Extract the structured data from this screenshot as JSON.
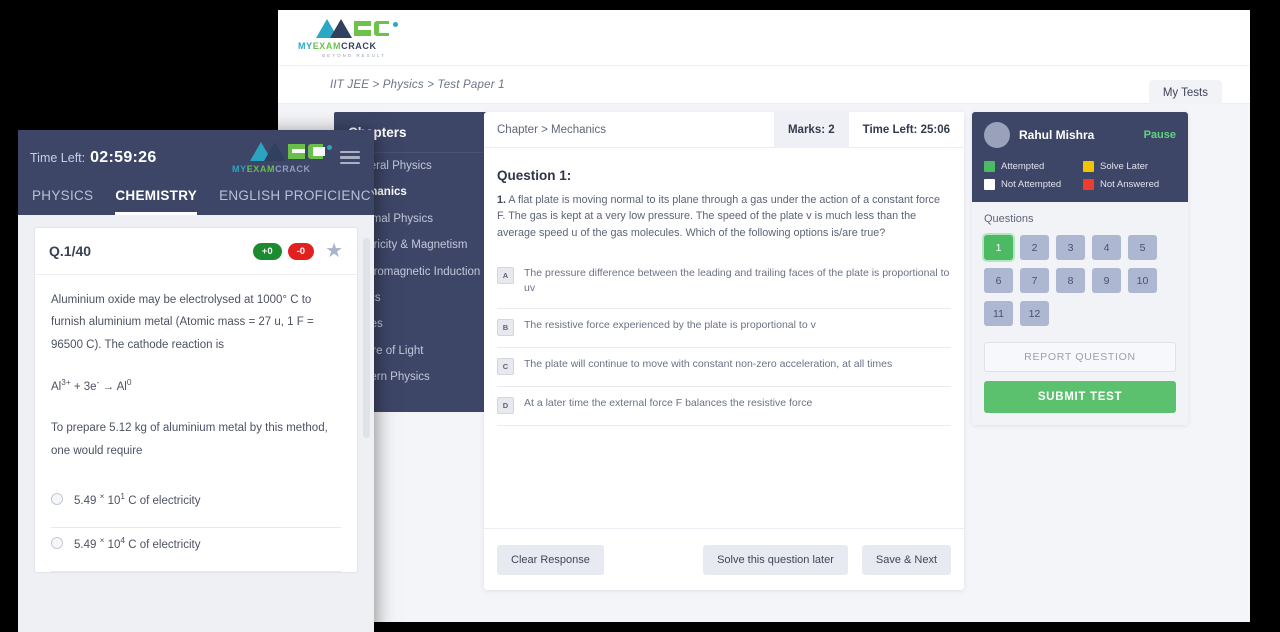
{
  "desktop": {
    "logo": {
      "mark": "mec-monogram",
      "word_my": "MY",
      "word_exam": "EXAM",
      "word_crack": "CRACK",
      "tagline": "BEYOND RESULT"
    },
    "breadcrumb": "IIT JEE > Physics > Test Paper 1",
    "my_tests_label": "My Tests",
    "chapters": {
      "title": "Chapters",
      "items": [
        {
          "label": "General Physics",
          "active": false
        },
        {
          "label": "Mechanics",
          "active": true
        },
        {
          "label": "Thermal Physics",
          "active": false
        },
        {
          "label": "Electricity & Magnetism",
          "active": false
        },
        {
          "label": "Electromagnetic Induction",
          "active": false
        },
        {
          "label": "Optics",
          "active": false
        },
        {
          "label": "Waves",
          "active": false
        },
        {
          "label": "Nature of Light",
          "active": false
        },
        {
          "label": "Modern Physics",
          "active": false
        }
      ]
    },
    "question": {
      "chapter_label": "Chapter > Mechanics",
      "marks": "Marks: 2",
      "time_left": "Time Left: 25:06",
      "title": "Question 1:",
      "number": "1.",
      "text": "A flat plate is moving normal to its plane through a gas under the action of a constant force F. The gas is kept at a very low pressure. The speed of the plate v is much less than the average speed u of the gas molecules. Which of the following options is/are true?",
      "options": [
        {
          "letter": "A",
          "text": "The pressure difference between the leading and trailing faces of the plate is proportional to uv"
        },
        {
          "letter": "B",
          "text": "The resistive force experienced by the plate is proportional to v"
        },
        {
          "letter": "C",
          "text": "The plate will continue to move with constant non-zero acceleration, at all times"
        },
        {
          "letter": "D",
          "text": "At a later time the external force F balances the resistive force"
        }
      ],
      "clear_label": "Clear Response",
      "later_label": "Solve this question later",
      "save_next_label": "Save & Next"
    },
    "panel": {
      "user_name": "Rahul Mishra",
      "pause_label": "Pause",
      "legend": [
        {
          "label": "Attempted",
          "color": "#4cb963"
        },
        {
          "label": "Solve Later",
          "color": "#f5c400"
        },
        {
          "label": "Not Attempted",
          "color": "#ffffff"
        },
        {
          "label": "Not Answered",
          "color": "#f03c2e"
        }
      ],
      "questions_title": "Questions",
      "questions": [
        {
          "n": "1",
          "state": "attempted"
        },
        {
          "n": "2",
          "state": "default"
        },
        {
          "n": "3",
          "state": "default"
        },
        {
          "n": "4",
          "state": "default"
        },
        {
          "n": "5",
          "state": "default"
        },
        {
          "n": "6",
          "state": "default"
        },
        {
          "n": "7",
          "state": "default"
        },
        {
          "n": "8",
          "state": "default"
        },
        {
          "n": "9",
          "state": "default"
        },
        {
          "n": "10",
          "state": "default"
        },
        {
          "n": "11",
          "state": "default"
        },
        {
          "n": "12",
          "state": "default"
        }
      ],
      "report_label": "REPORT QUESTION",
      "submit_label": "SUBMIT TEST"
    }
  },
  "mobile": {
    "time_label": "Time Left:",
    "time_value": "02:59:26",
    "menu_icon": "hamburger-icon",
    "tabs": [
      {
        "label": "PHYSICS",
        "active": false
      },
      {
        "label": "CHEMISTRY",
        "active": true
      },
      {
        "label": "ENGLISH PROFICIENCY",
        "active": false
      }
    ],
    "card": {
      "question_no": "Q.1/40",
      "positive_marks": "+0",
      "negative_marks": "-0",
      "bookmark_icon": "star-icon",
      "text": "Aluminium oxide may be electrolysed at 1000° C to furnish aluminium metal (Atomic mass = 27 u, 1 F = 96500 C). The cathode reaction is",
      "equation_lhs": "Al",
      "equation_lhs_sup": "3+",
      "equation_mid": " + 3e",
      "equation_mid_sup": "-",
      "equation_arrow": "→",
      "equation_rhs": "Al",
      "equation_rhs_sup": "0",
      "sub_text": "To prepare 5.12 kg of aluminium metal by this method, one would require",
      "options": [
        {
          "value": "5.49",
          "times": "×",
          "base": "10",
          "exp": "1",
          "unit": "C of electricity"
        },
        {
          "value": "5.49",
          "times": "×",
          "base": "10",
          "exp": "4",
          "unit": "C of electricity"
        }
      ]
    }
  },
  "colors": {
    "navy": "#3e4668",
    "green": "#5cc16e",
    "yellow": "#f5c400",
    "red": "#f03c2e",
    "grid_box": "#aeb7d1"
  }
}
